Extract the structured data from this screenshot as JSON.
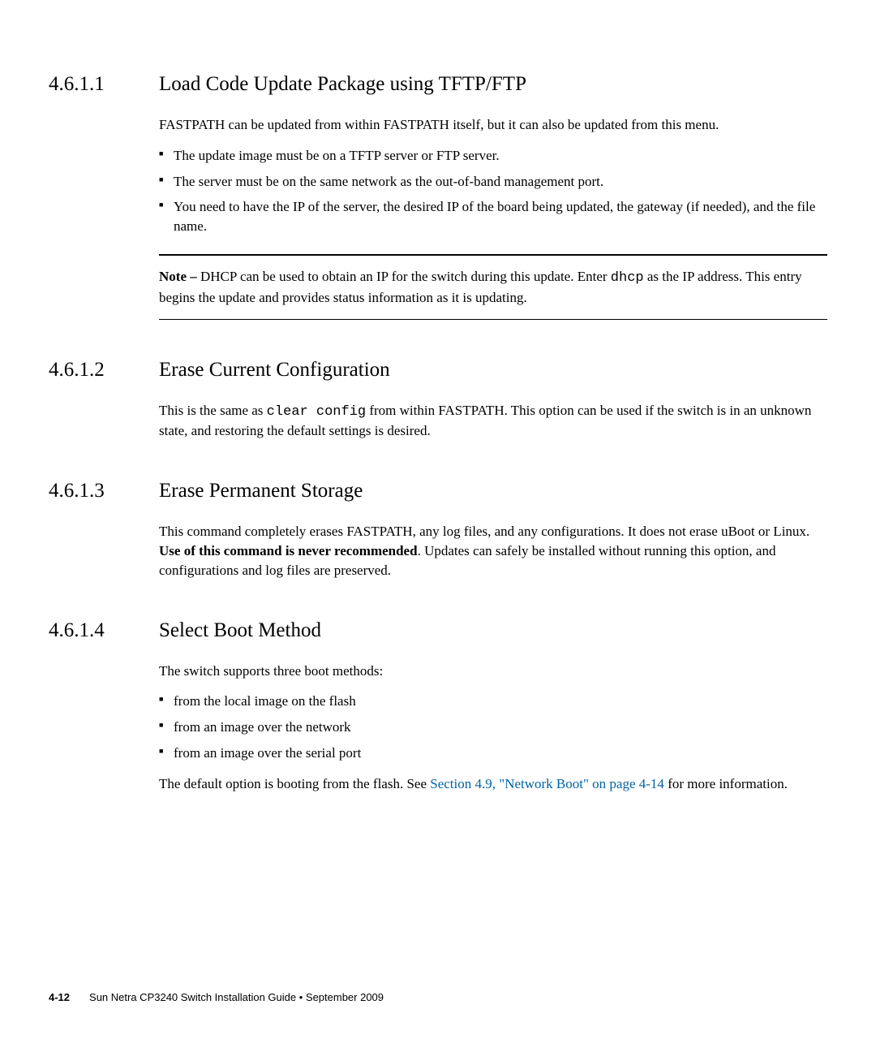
{
  "sections": [
    {
      "number": "4.6.1.1",
      "title": "Load Code Update Package using TFTP/FTP",
      "intro": "FASTPATH can be updated from within FASTPATH itself, but it can also be updated from this menu.",
      "bullets": [
        "The update image must be on a TFTP server or FTP server.",
        "The server must be on the same network as the out-of-band management port.",
        "You need to have the IP of the server, the desired IP of the board being updated, the gateway (if needed), and the file name."
      ],
      "note": {
        "label": "Note –",
        "before_mono": " DHCP can be used to obtain an IP for the switch during this update. Enter ",
        "mono": "dhcp",
        "after_mono": " as the IP address. This entry begins the update and provides status information as it is updating."
      }
    },
    {
      "number": "4.6.1.2",
      "title": "Erase Current Configuration",
      "para_before_mono": "This is the same as ",
      "mono": "clear config",
      "para_after_mono": " from within FASTPATH. This option can be used if the switch is in an unknown state, and restoring the default settings is desired."
    },
    {
      "number": "4.6.1.3",
      "title": "Erase Permanent Storage",
      "para_before_bold": "This command completely erases FASTPATH, any log files, and any configurations. It does not erase uBoot or Linux.  ",
      "bold": "Use of this command is never recommended",
      "para_after_bold": ". Updates can safely be installed without running this option, and configurations and log files are preserved."
    },
    {
      "number": "4.6.1.4",
      "title": "Select Boot Method",
      "intro": "The switch supports three boot methods:",
      "bullets": [
        "from the local image on the flash",
        "from an image over the network",
        "from an image over the serial port"
      ],
      "outro_before_link": "The default option is booting from the flash. See ",
      "link": "Section 4.9, \"Network Boot\" on page 4-14",
      "outro_after_link": " for more information."
    }
  ],
  "footer": {
    "page": "4-12",
    "text": "Sun Netra CP3240 Switch Installation Guide  •  September 2009"
  }
}
